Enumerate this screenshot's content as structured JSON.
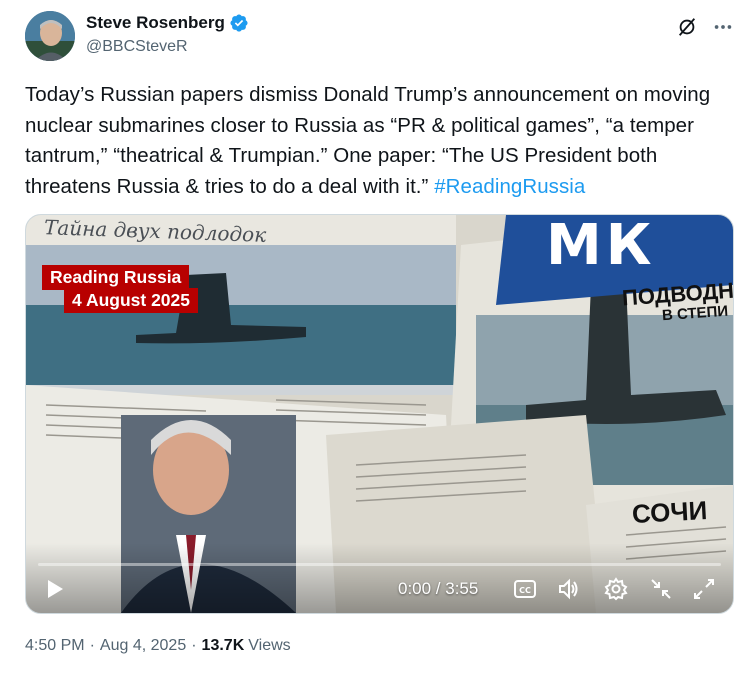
{
  "author": {
    "display_name": "Steve Rosenberg",
    "handle": "@BBCSteveR",
    "verified": true
  },
  "top_icons": [
    "grok-slash-icon",
    "more-options-icon"
  ],
  "tweet": {
    "text": "Today’s Russian papers dismiss Donald Trump’s announcement on moving nuclear submarines closer to Russia as “PR & political games”, “a temper tantrum,” “theatrical & Trumpian.” One paper: “The US President both threatens Russia & tries to do a deal with it.” ",
    "hashtag": "#ReadingRussia"
  },
  "media": {
    "overlay_line1": "Reading Russia",
    "overlay_line2": "4 August 2025",
    "newspaper_headline_left": "Тайна двух подлодок",
    "newspaper_mk_masthead": "МК",
    "newspaper_headline_right_1": "ПОДВОДНЬ",
    "newspaper_headline_right_2": "В СТЕПИ",
    "newspaper_sochi": "СОЧИ",
    "time_display": "0:00 / 3:55",
    "progress": 0,
    "controls": [
      "play-icon",
      "captions-icon",
      "volume-icon",
      "settings-icon",
      "minimize-icon",
      "fullscreen-icon"
    ],
    "captions_label": "CC"
  },
  "footer": {
    "time": "4:50 PM",
    "date": "Aug 4, 2025",
    "views_count": "13.7K",
    "views_label": "Views",
    "separator": "·"
  },
  "colors": {
    "accent": "#1d9bf0",
    "text": "#0f1419",
    "secondary": "#536471",
    "overlay_red": "#b80000"
  }
}
